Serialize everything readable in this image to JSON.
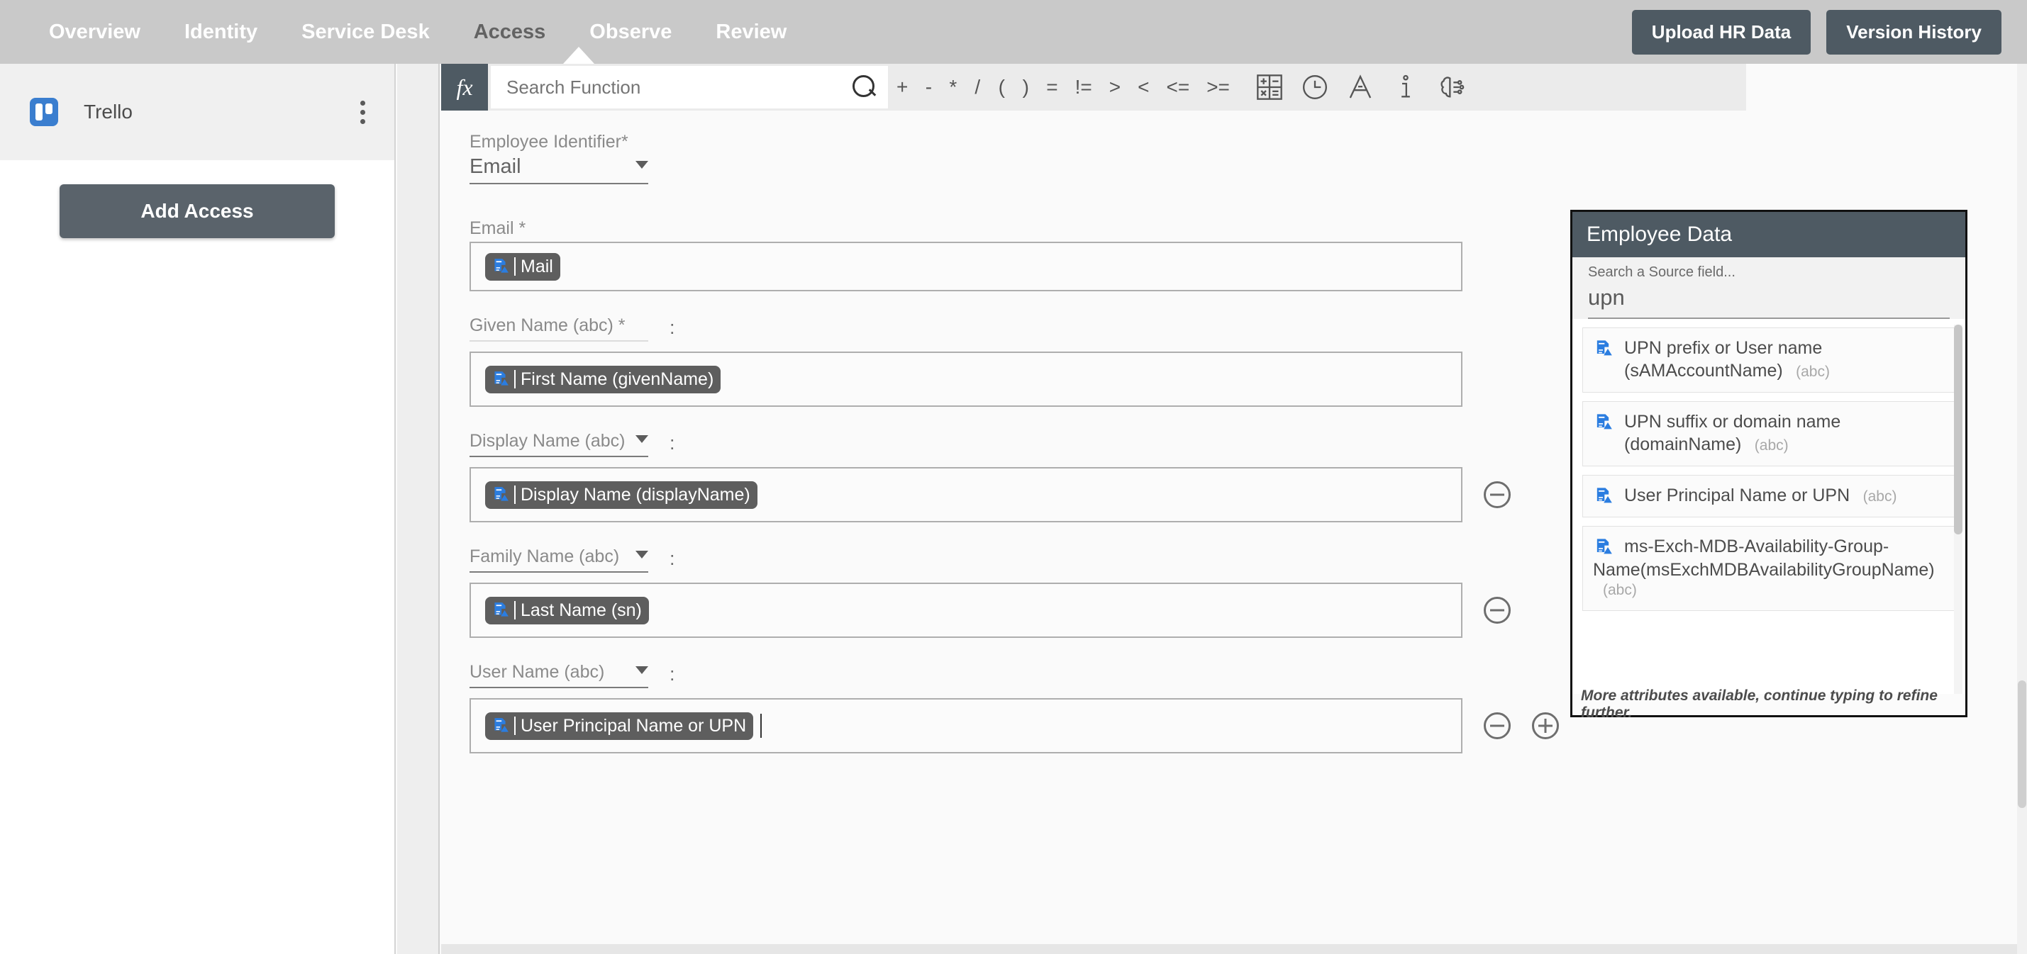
{
  "topnav": {
    "tabs": [
      {
        "label": "Overview",
        "active": false
      },
      {
        "label": "Identity",
        "active": false
      },
      {
        "label": "Service Desk",
        "active": false
      },
      {
        "label": "Access",
        "active": true
      },
      {
        "label": "Observe",
        "active": false
      },
      {
        "label": "Review",
        "active": false
      }
    ],
    "upload_button": "Upload HR Data",
    "version_button": "Version History",
    "bg_color": "#c9c9c9",
    "button_color": "#4e5a63"
  },
  "sidebar": {
    "app_name": "Trello",
    "app_icon": "trello-icon",
    "menu_icon": "kebab-menu-icon",
    "add_access_button": "Add Access"
  },
  "toolbar": {
    "fx_label": "fx",
    "search_placeholder": "Search Function",
    "search_value": "",
    "search_icon": "search-icon",
    "operators": [
      "+",
      "-",
      "*",
      "/",
      "(",
      ")",
      "=",
      "!=",
      ">",
      "<",
      "<=",
      ">="
    ],
    "icons": [
      {
        "name": "math-operations-icon"
      },
      {
        "name": "clock-icon"
      },
      {
        "name": "text-format-icon"
      },
      {
        "name": "info-icon"
      },
      {
        "name": "ai-brain-icon"
      }
    ]
  },
  "form": {
    "employee_identifier": {
      "label": "Employee Identifier*",
      "value": "Email"
    },
    "fields": [
      {
        "label": "Email *",
        "has_caret": false,
        "has_colon": false,
        "underline": "none",
        "chip": {
          "text": "Mail",
          "icon": "attribute-icon"
        },
        "cursor": false,
        "minus": false,
        "plus": false
      },
      {
        "label": "Given Name (abc) *",
        "has_caret": false,
        "has_colon": true,
        "underline": "light",
        "chip": {
          "text": "First Name (givenName)",
          "icon": "attribute-icon"
        },
        "cursor": false,
        "minus": false,
        "plus": false
      },
      {
        "label": "Display Name (abc)",
        "has_caret": true,
        "has_colon": true,
        "underline": "dark",
        "chip": {
          "text": "Display Name (displayName)",
          "icon": "attribute-icon"
        },
        "cursor": false,
        "minus": true,
        "plus": false
      },
      {
        "label": "Family Name (abc)",
        "has_caret": true,
        "has_colon": true,
        "underline": "dark",
        "chip": {
          "text": "Last Name (sn)",
          "icon": "attribute-icon"
        },
        "cursor": false,
        "minus": true,
        "plus": false
      },
      {
        "label": "User Name (abc)",
        "has_caret": true,
        "has_colon": true,
        "underline": "dark",
        "chip": {
          "text": "User Principal Name or UPN",
          "icon": "attribute-icon"
        },
        "cursor": true,
        "minus": true,
        "plus": true
      }
    ]
  },
  "employee_data_panel": {
    "title": "Employee Data",
    "search_label": "Search a Source field...",
    "search_value": "upn",
    "items": [
      {
        "name": "UPN prefix or User name (sAMAccountName)",
        "type": "(abc)",
        "icon": "attribute-icon"
      },
      {
        "name": "UPN suffix or domain name (domainName)",
        "type": "(abc)",
        "icon": "attribute-icon"
      },
      {
        "name": "User Principal Name or UPN",
        "type": "(abc)",
        "icon": "attribute-icon"
      },
      {
        "name": "ms-Exch-MDB-Availability-Group-Name(msExchMDBAvailabilityGroupName)",
        "type": "(abc)",
        "icon": "attribute-icon"
      }
    ],
    "footer_note": "More attributes available, continue typing to refine further.",
    "header_color": "#4e5a63"
  }
}
